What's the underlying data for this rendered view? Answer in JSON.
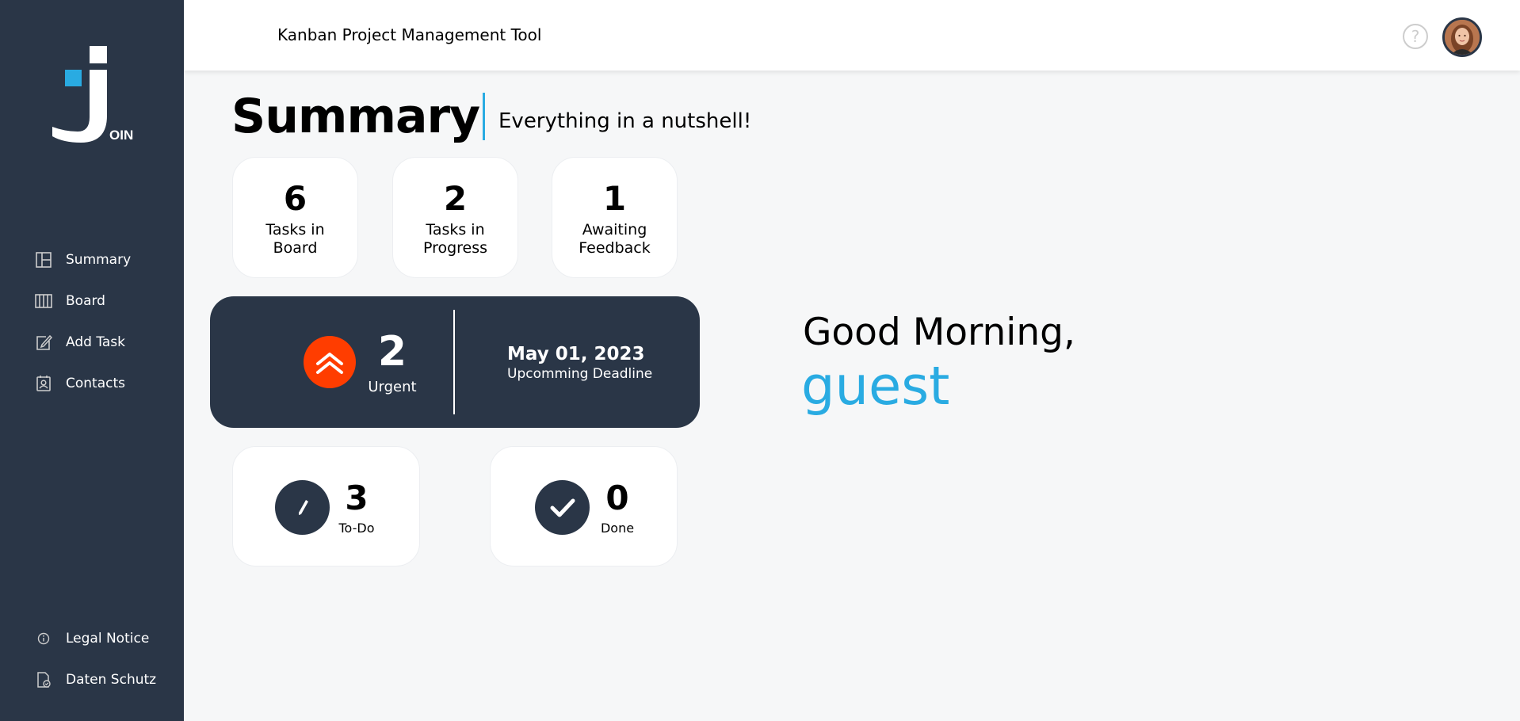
{
  "sidebar": {
    "logo_text": "OIN",
    "nav": [
      {
        "label": "Summary",
        "icon": "summary-icon"
      },
      {
        "label": "Board",
        "icon": "board-icon"
      },
      {
        "label": "Add Task",
        "icon": "add-task-icon"
      },
      {
        "label": "Contacts",
        "icon": "contacts-icon"
      }
    ],
    "footer": [
      {
        "label": "Legal Notice",
        "icon": "info-icon"
      },
      {
        "label": "Daten Schutz",
        "icon": "privacy-icon"
      }
    ]
  },
  "header": {
    "title": "Kanban Project Management Tool",
    "help_label": "?"
  },
  "summary": {
    "title": "Summary",
    "subtitle": "Everything in a nutshell!",
    "stats": [
      {
        "count": "6",
        "label": "Tasks in Board"
      },
      {
        "count": "2",
        "label": "Tasks in Progress"
      },
      {
        "count": "1",
        "label": "Awaiting Feedback"
      }
    ],
    "urgent": {
      "count": "2",
      "label": "Urgent"
    },
    "deadline": {
      "date": "May 01, 2023",
      "label": "Upcomming Deadline"
    },
    "todo": {
      "count": "3",
      "label": "To-Do"
    },
    "done": {
      "count": "0",
      "label": "Done"
    }
  },
  "greeting": {
    "text": "Good Morning,",
    "name": "guest"
  },
  "colors": {
    "sidebar_bg": "#2a3647",
    "accent": "#29abe2",
    "urgent": "#ff3d00"
  }
}
